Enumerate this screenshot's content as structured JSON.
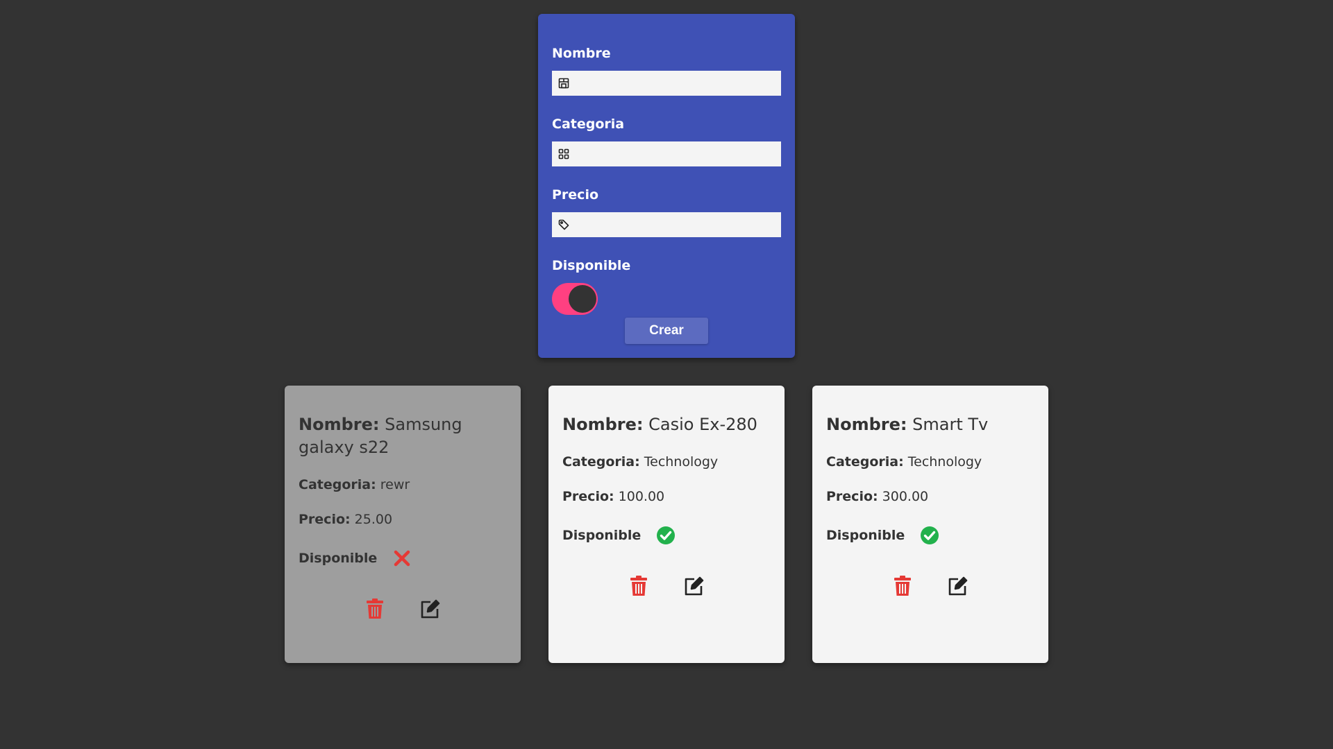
{
  "form": {
    "name_label": "Nombre",
    "name_value": "",
    "category_label": "Categoria",
    "category_value": "",
    "price_label": "Precio",
    "price_value": "",
    "available_label": "Disponible",
    "available_on": true,
    "submit_label": "Crear",
    "icons": [
      "store-icon",
      "grid-icon",
      "tag-icon"
    ]
  },
  "colors": {
    "background": "#333333",
    "form": "#3f51b5",
    "toggle_track": "#ff4081",
    "button": "#5c6bc0",
    "card_available": "#f4f4f4",
    "card_unavailable": "#9e9e9e",
    "delete": "#e53935",
    "check": "#22b14c",
    "cross": "#e53935"
  },
  "products": [
    {
      "name_label": "Nombre:",
      "name": "Samsung galaxy s22",
      "category_label": "Categoria:",
      "category": "rewr",
      "price_label": "Precio:",
      "price": "25.00",
      "available_label": "Disponible",
      "available": false
    },
    {
      "name_label": "Nombre:",
      "name": "Casio Ex-280",
      "category_label": "Categoria:",
      "category": "Technology",
      "price_label": "Precio:",
      "price": "100.00",
      "available_label": "Disponible",
      "available": true
    },
    {
      "name_label": "Nombre:",
      "name": "Smart Tv",
      "category_label": "Categoria:",
      "category": "Technology",
      "price_label": "Precio:",
      "price": "300.00",
      "available_label": "Disponible",
      "available": true
    }
  ]
}
